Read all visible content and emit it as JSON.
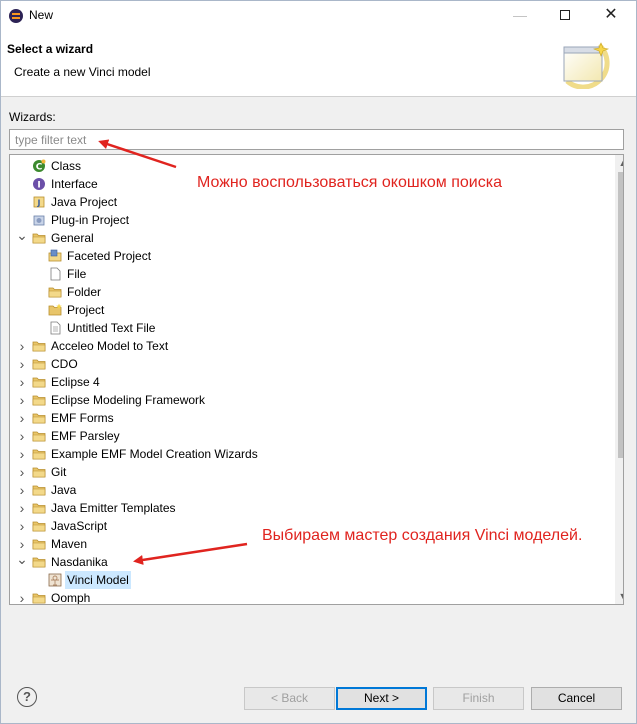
{
  "window": {
    "title": "New",
    "min_icon": "minimize-icon",
    "max_icon": "maximize-icon",
    "close_icon": "close-icon"
  },
  "header": {
    "title": "Select a wizard",
    "description": "Create a new Vinci model",
    "banner_icon": "new-wizard-banner-icon"
  },
  "wizards": {
    "label": "Wizards:",
    "filter_placeholder": "type filter text",
    "filter_value": ""
  },
  "tree": {
    "items": [
      {
        "label": "Class",
        "level": 0,
        "twisty": "none",
        "icon": "class-icon",
        "color": "#3c8a2e"
      },
      {
        "label": "Interface",
        "level": 0,
        "twisty": "none",
        "icon": "interface-icon",
        "color": "#6b4fa8"
      },
      {
        "label": "Java Project",
        "level": 0,
        "twisty": "none",
        "icon": "java-project-icon",
        "color": "#c49a3a"
      },
      {
        "label": "Plug-in Project",
        "level": 0,
        "twisty": "none",
        "icon": "plugin-project-icon",
        "color": "#6a7fa8"
      },
      {
        "label": "General",
        "level": 0,
        "twisty": "expanded",
        "icon": "folder-icon",
        "color": "#e8c56a"
      },
      {
        "label": "Faceted Project",
        "level": 1,
        "twisty": "none",
        "icon": "faceted-project-icon",
        "color": "#6a8fc8"
      },
      {
        "label": "File",
        "level": 1,
        "twisty": "none",
        "icon": "file-icon",
        "color": "#ffffff"
      },
      {
        "label": "Folder",
        "level": 1,
        "twisty": "none",
        "icon": "folder-icon",
        "color": "#e8c56a"
      },
      {
        "label": "Project",
        "level": 1,
        "twisty": "none",
        "icon": "project-icon",
        "color": "#e8c56a"
      },
      {
        "label": "Untitled Text File",
        "level": 1,
        "twisty": "none",
        "icon": "text-file-icon",
        "color": "#ffffff"
      },
      {
        "label": "Acceleo Model to Text",
        "level": 0,
        "twisty": "collapsed",
        "icon": "folder-icon",
        "color": "#e8c56a"
      },
      {
        "label": "CDO",
        "level": 0,
        "twisty": "collapsed",
        "icon": "folder-icon",
        "color": "#e8c56a"
      },
      {
        "label": "Eclipse 4",
        "level": 0,
        "twisty": "collapsed",
        "icon": "folder-icon",
        "color": "#e8c56a"
      },
      {
        "label": "Eclipse Modeling Framework",
        "level": 0,
        "twisty": "collapsed",
        "icon": "folder-icon",
        "color": "#e8c56a"
      },
      {
        "label": "EMF Forms",
        "level": 0,
        "twisty": "collapsed",
        "icon": "folder-icon",
        "color": "#e8c56a"
      },
      {
        "label": "EMF Parsley",
        "level": 0,
        "twisty": "collapsed",
        "icon": "folder-icon",
        "color": "#e8c56a"
      },
      {
        "label": "Example EMF Model Creation Wizards",
        "level": 0,
        "twisty": "collapsed",
        "icon": "folder-icon",
        "color": "#e8c56a"
      },
      {
        "label": "Git",
        "level": 0,
        "twisty": "collapsed",
        "icon": "folder-icon",
        "color": "#e8c56a"
      },
      {
        "label": "Java",
        "level": 0,
        "twisty": "collapsed",
        "icon": "folder-icon",
        "color": "#e8c56a"
      },
      {
        "label": "Java Emitter Templates",
        "level": 0,
        "twisty": "collapsed",
        "icon": "folder-icon",
        "color": "#e8c56a"
      },
      {
        "label": "JavaScript",
        "level": 0,
        "twisty": "collapsed",
        "icon": "folder-icon",
        "color": "#e8c56a"
      },
      {
        "label": "Maven",
        "level": 0,
        "twisty": "collapsed",
        "icon": "folder-icon",
        "color": "#e8c56a"
      },
      {
        "label": "Nasdanika",
        "level": 0,
        "twisty": "expanded",
        "icon": "folder-icon",
        "color": "#e8c56a"
      },
      {
        "label": "Vinci Model",
        "level": 1,
        "twisty": "none",
        "icon": "vinci-model-icon",
        "color": "#b08a6a",
        "selected": true
      },
      {
        "label": "Oomph",
        "level": 0,
        "twisty": "collapsed",
        "icon": "folder-icon",
        "color": "#e8c56a"
      }
    ],
    "scroll_up_icon": "scroll-up-icon",
    "scroll_down_icon": "scroll-down-icon"
  },
  "annotations": {
    "search_hint": "Можно воспользоваться окошком поиска",
    "wizard_hint": "Выбираем мастер создания Vinci моделей.",
    "color": "#e0241f"
  },
  "buttons": {
    "help_icon": "help-icon",
    "back": "< Back",
    "next": "Next >",
    "finish": "Finish",
    "cancel": "Cancel"
  }
}
